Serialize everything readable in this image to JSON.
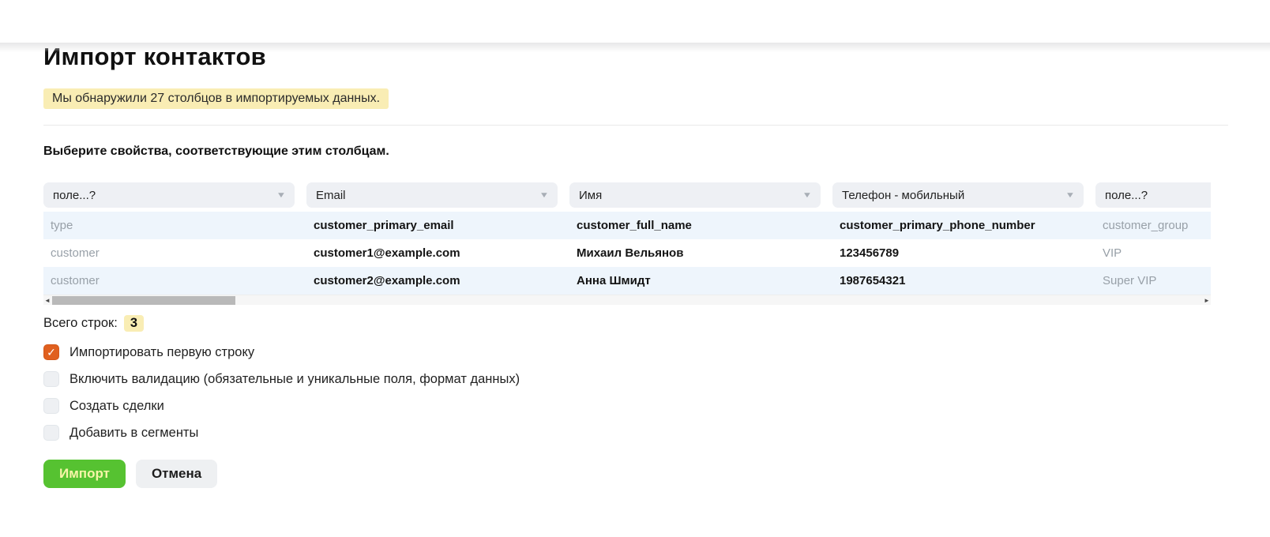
{
  "page": {
    "title": "Импорт контактов",
    "alert": "Мы обнаружили 27 столбцов в импортируемых данных.",
    "subtitle": "Выберите свойства, соответствующие этим столбцам."
  },
  "mapping": {
    "selects": [
      {
        "value": "поле...?"
      },
      {
        "value": "Email"
      },
      {
        "value": "Имя"
      },
      {
        "value": "Телефон - мобильный"
      },
      {
        "value": "поле...?"
      }
    ]
  },
  "table": {
    "rows": [
      [
        "type",
        "customer_primary_email",
        "customer_full_name",
        "customer_primary_phone_number",
        "customer_group"
      ],
      [
        "customer",
        "customer1@example.com",
        "Михаил Вельянов",
        "123456789",
        "VIP"
      ],
      [
        "customer",
        "customer2@example.com",
        "Анна Шмидт",
        "1987654321",
        "Super VIP"
      ]
    ]
  },
  "totals": {
    "label": "Всего строк:",
    "value": "3"
  },
  "options": [
    {
      "label": "Импортировать первую строку",
      "checked": true
    },
    {
      "label": "Включить валидацию (обязательные и уникальные поля, формат данных)",
      "checked": false
    },
    {
      "label": "Создать сделки",
      "checked": false
    },
    {
      "label": "Добавить в сегменты",
      "checked": false
    }
  ],
  "actions": {
    "import": "Импорт",
    "cancel": "Отмена"
  },
  "icons": {
    "chevron_down": "▼",
    "check": "✓",
    "scroll_left": "◄",
    "scroll_right": "►"
  },
  "colors": {
    "highlight_yellow": "#f9edb4",
    "row_stripe_blue": "#eef5fc",
    "checked_orange": "#e0601f",
    "button_green": "#56c231"
  }
}
